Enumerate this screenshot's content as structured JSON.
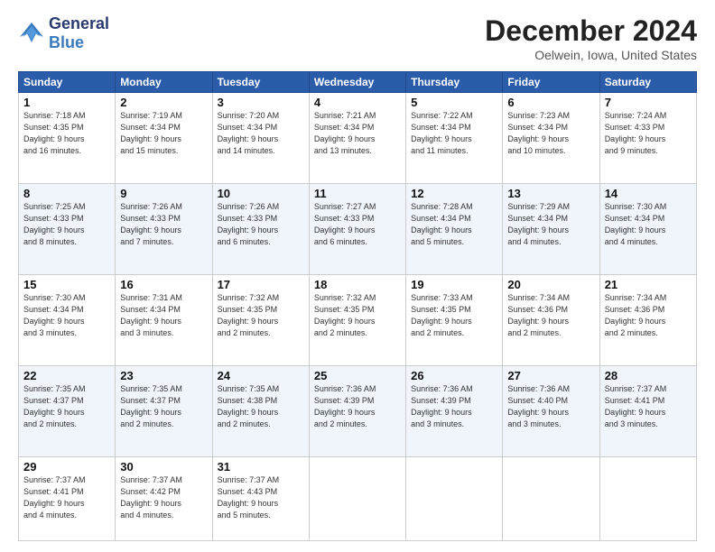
{
  "logo": {
    "line1": "General",
    "line2": "Blue"
  },
  "title": "December 2024",
  "location": "Oelwein, Iowa, United States",
  "days_of_week": [
    "Sunday",
    "Monday",
    "Tuesday",
    "Wednesday",
    "Thursday",
    "Friday",
    "Saturday"
  ],
  "weeks": [
    [
      {
        "day": "1",
        "info": "Sunrise: 7:18 AM\nSunset: 4:35 PM\nDaylight: 9 hours\nand 16 minutes."
      },
      {
        "day": "2",
        "info": "Sunrise: 7:19 AM\nSunset: 4:34 PM\nDaylight: 9 hours\nand 15 minutes."
      },
      {
        "day": "3",
        "info": "Sunrise: 7:20 AM\nSunset: 4:34 PM\nDaylight: 9 hours\nand 14 minutes."
      },
      {
        "day": "4",
        "info": "Sunrise: 7:21 AM\nSunset: 4:34 PM\nDaylight: 9 hours\nand 13 minutes."
      },
      {
        "day": "5",
        "info": "Sunrise: 7:22 AM\nSunset: 4:34 PM\nDaylight: 9 hours\nand 11 minutes."
      },
      {
        "day": "6",
        "info": "Sunrise: 7:23 AM\nSunset: 4:34 PM\nDaylight: 9 hours\nand 10 minutes."
      },
      {
        "day": "7",
        "info": "Sunrise: 7:24 AM\nSunset: 4:33 PM\nDaylight: 9 hours\nand 9 minutes."
      }
    ],
    [
      {
        "day": "8",
        "info": "Sunrise: 7:25 AM\nSunset: 4:33 PM\nDaylight: 9 hours\nand 8 minutes."
      },
      {
        "day": "9",
        "info": "Sunrise: 7:26 AM\nSunset: 4:33 PM\nDaylight: 9 hours\nand 7 minutes."
      },
      {
        "day": "10",
        "info": "Sunrise: 7:26 AM\nSunset: 4:33 PM\nDaylight: 9 hours\nand 6 minutes."
      },
      {
        "day": "11",
        "info": "Sunrise: 7:27 AM\nSunset: 4:33 PM\nDaylight: 9 hours\nand 6 minutes."
      },
      {
        "day": "12",
        "info": "Sunrise: 7:28 AM\nSunset: 4:34 PM\nDaylight: 9 hours\nand 5 minutes."
      },
      {
        "day": "13",
        "info": "Sunrise: 7:29 AM\nSunset: 4:34 PM\nDaylight: 9 hours\nand 4 minutes."
      },
      {
        "day": "14",
        "info": "Sunrise: 7:30 AM\nSunset: 4:34 PM\nDaylight: 9 hours\nand 4 minutes."
      }
    ],
    [
      {
        "day": "15",
        "info": "Sunrise: 7:30 AM\nSunset: 4:34 PM\nDaylight: 9 hours\nand 3 minutes."
      },
      {
        "day": "16",
        "info": "Sunrise: 7:31 AM\nSunset: 4:34 PM\nDaylight: 9 hours\nand 3 minutes."
      },
      {
        "day": "17",
        "info": "Sunrise: 7:32 AM\nSunset: 4:35 PM\nDaylight: 9 hours\nand 2 minutes."
      },
      {
        "day": "18",
        "info": "Sunrise: 7:32 AM\nSunset: 4:35 PM\nDaylight: 9 hours\nand 2 minutes."
      },
      {
        "day": "19",
        "info": "Sunrise: 7:33 AM\nSunset: 4:35 PM\nDaylight: 9 hours\nand 2 minutes."
      },
      {
        "day": "20",
        "info": "Sunrise: 7:34 AM\nSunset: 4:36 PM\nDaylight: 9 hours\nand 2 minutes."
      },
      {
        "day": "21",
        "info": "Sunrise: 7:34 AM\nSunset: 4:36 PM\nDaylight: 9 hours\nand 2 minutes."
      }
    ],
    [
      {
        "day": "22",
        "info": "Sunrise: 7:35 AM\nSunset: 4:37 PM\nDaylight: 9 hours\nand 2 minutes."
      },
      {
        "day": "23",
        "info": "Sunrise: 7:35 AM\nSunset: 4:37 PM\nDaylight: 9 hours\nand 2 minutes."
      },
      {
        "day": "24",
        "info": "Sunrise: 7:35 AM\nSunset: 4:38 PM\nDaylight: 9 hours\nand 2 minutes."
      },
      {
        "day": "25",
        "info": "Sunrise: 7:36 AM\nSunset: 4:39 PM\nDaylight: 9 hours\nand 2 minutes."
      },
      {
        "day": "26",
        "info": "Sunrise: 7:36 AM\nSunset: 4:39 PM\nDaylight: 9 hours\nand 3 minutes."
      },
      {
        "day": "27",
        "info": "Sunrise: 7:36 AM\nSunset: 4:40 PM\nDaylight: 9 hours\nand 3 minutes."
      },
      {
        "day": "28",
        "info": "Sunrise: 7:37 AM\nSunset: 4:41 PM\nDaylight: 9 hours\nand 3 minutes."
      }
    ],
    [
      {
        "day": "29",
        "info": "Sunrise: 7:37 AM\nSunset: 4:41 PM\nDaylight: 9 hours\nand 4 minutes."
      },
      {
        "day": "30",
        "info": "Sunrise: 7:37 AM\nSunset: 4:42 PM\nDaylight: 9 hours\nand 4 minutes."
      },
      {
        "day": "31",
        "info": "Sunrise: 7:37 AM\nSunset: 4:43 PM\nDaylight: 9 hours\nand 5 minutes."
      },
      {
        "day": "",
        "info": ""
      },
      {
        "day": "",
        "info": ""
      },
      {
        "day": "",
        "info": ""
      },
      {
        "day": "",
        "info": ""
      }
    ]
  ]
}
